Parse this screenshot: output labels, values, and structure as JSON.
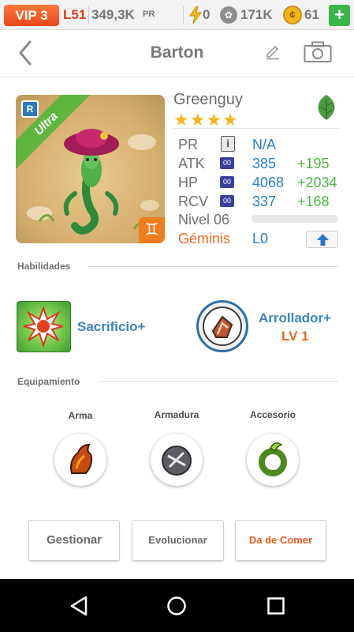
{
  "status_bar": {
    "vip": "VIP 3",
    "level": "L51",
    "pr_value": "349,3K",
    "pr_unit": "PR",
    "energy": "0",
    "paws": "171K",
    "coins": "61",
    "add_label": "+"
  },
  "header": {
    "title": "Barton"
  },
  "monster": {
    "name": "Greenguy",
    "stars": "★★★★",
    "rarity_ribbon": "Ultra",
    "rarity_badge": "R",
    "zodiac_symbol": "♊",
    "stats": {
      "pr": {
        "label": "PR",
        "value": "N/A"
      },
      "atk": {
        "label": "ATK",
        "value": "385",
        "bonus": "+195"
      },
      "hp": {
        "label": "HP",
        "value": "4068",
        "bonus": "+2034"
      },
      "rcv": {
        "label": "RCV",
        "value": "337",
        "bonus": "+168"
      }
    },
    "level_label": "Nivel 06",
    "level_progress": 0,
    "zodiac_label": "Géminis",
    "zodiac_level": "L0"
  },
  "abilities": {
    "title": "Habilidades",
    "skill1": {
      "name": "Sacrificio+"
    },
    "skill2": {
      "name": "Arrollador+",
      "level": "LV 1"
    }
  },
  "equipment": {
    "title": "Equipamiento",
    "slots": [
      {
        "label": "Arma"
      },
      {
        "label": "Armadura"
      },
      {
        "label": "Accesorio"
      }
    ]
  },
  "buttons": {
    "manage": "Gestionar",
    "evolve": "Evolucionar",
    "feed": "Da de Comer"
  },
  "colors": {
    "accent_orange": "#ee6a1f",
    "stat_blue": "#2a7fc6",
    "bonus_green": "#4fb648"
  }
}
